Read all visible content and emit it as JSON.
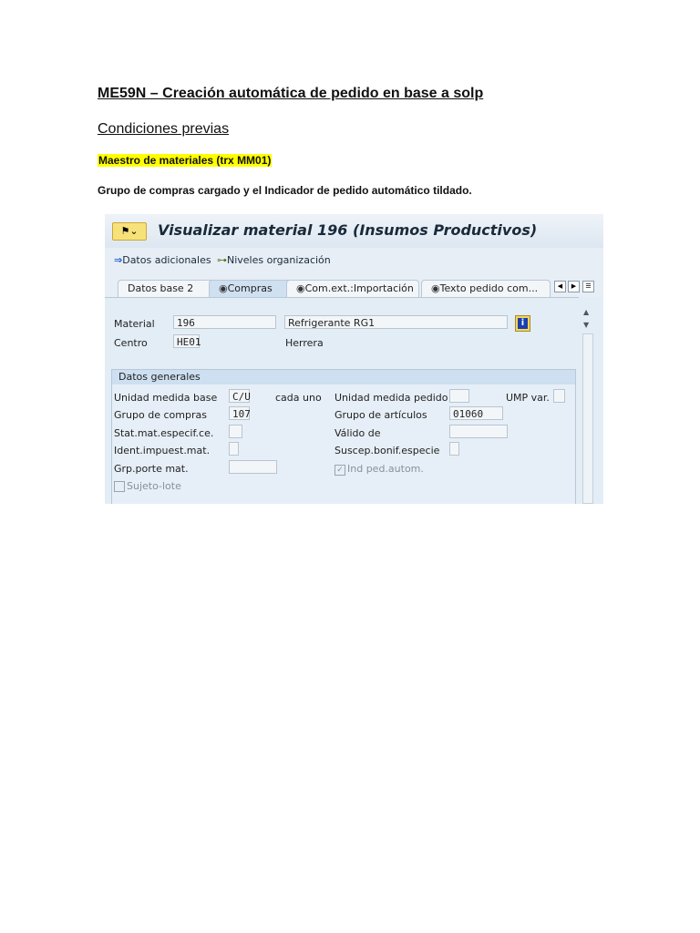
{
  "doc": {
    "title": "ME59N – Creación automática de pedido en base a solp",
    "subtitle": "Condiciones previas",
    "highlight": "Maestro de materiales (trx MM01)",
    "paragraph": "Grupo de compras cargado y el Indicador de pedido automático tildado."
  },
  "sap": {
    "window_title": "Visualizar material 196 (Insumos Productivos)",
    "toolbar": {
      "datos_adicionales": "Datos adicionales",
      "niveles": "Niveles organización"
    },
    "tabs": [
      "Datos base 2",
      "Compras",
      "Com.ext.:Importación",
      "Texto pedido com..."
    ],
    "header": {
      "material_label": "Material",
      "material": "196",
      "description": "Refrigerante RG1",
      "centro_label": "Centro",
      "centro": "HE01",
      "centro_name": "Herrera"
    },
    "group": {
      "title": "Datos generales",
      "unidad_base_label": "Unidad medida base",
      "unidad_base": "C/U",
      "unidad_base_text": "cada uno",
      "grupo_compras_label": "Grupo de compras",
      "grupo_compras": "107",
      "stat_label": "Stat.mat.especif.ce.",
      "ident_label": "Ident.impuest.mat.",
      "grp_porte_label": "Grp.porte mat.",
      "unidad_pedido_label": "Unidad medida pedido",
      "ump_var_label": "UMP var.",
      "grupo_art_label": "Grupo de artículos",
      "grupo_art": "01060",
      "valido_label": "Válido de",
      "suscep_label": "Suscep.bonif.especie",
      "ind_ped_label": "Ind ped.autom.",
      "ind_ped_checked": true,
      "sujeto_lote_label": "Sujeto-lote",
      "sujeto_lote_checked": false
    }
  }
}
